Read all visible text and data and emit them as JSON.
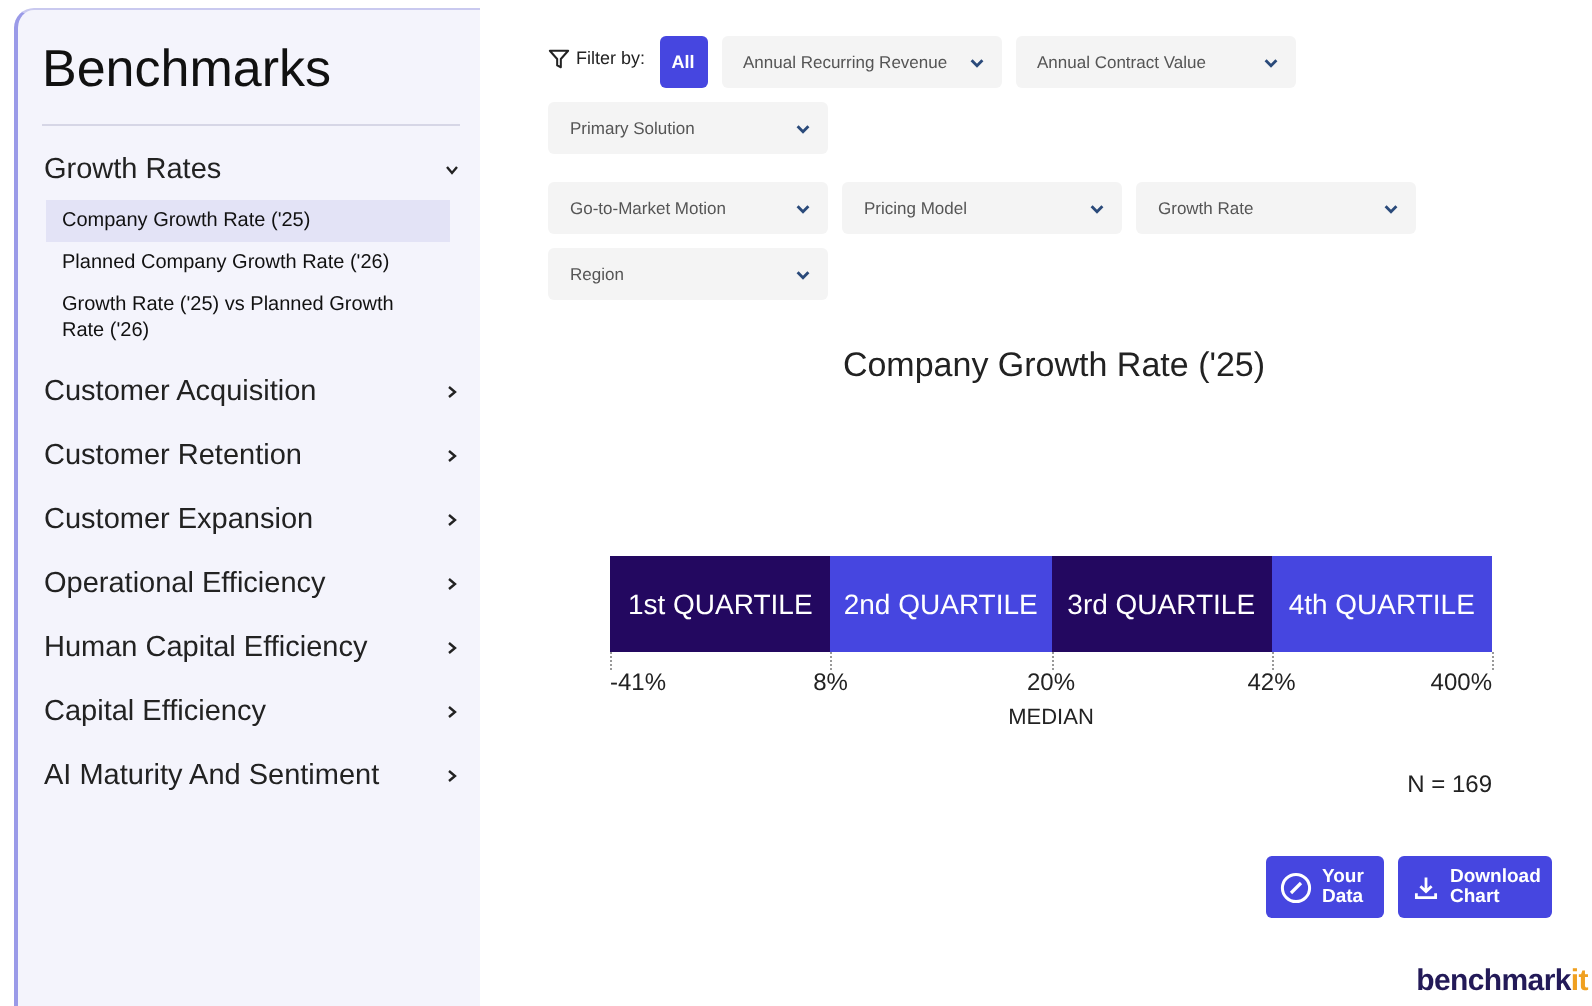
{
  "sidebar": {
    "title": "Benchmarks",
    "sections": [
      {
        "label": "Growth Rates",
        "expanded": true,
        "children": [
          {
            "label": "Company Growth Rate ('25)",
            "selected": true
          },
          {
            "label": "Planned Company Growth Rate ('26)",
            "selected": false
          },
          {
            "label": "Growth Rate ('25) vs Planned Growth Rate ('26)",
            "selected": false
          }
        ]
      },
      {
        "label": "Customer Acquisition",
        "expanded": false
      },
      {
        "label": "Customer Retention",
        "expanded": false
      },
      {
        "label": "Customer Expansion",
        "expanded": false
      },
      {
        "label": "Operational Efficiency",
        "expanded": false
      },
      {
        "label": "Human Capital Efficiency",
        "expanded": false
      },
      {
        "label": "Capital Efficiency",
        "expanded": false
      },
      {
        "label": "AI Maturity And Sentiment",
        "expanded": false
      }
    ]
  },
  "filters": {
    "label": "Filter by:",
    "all_button": "All",
    "dropdowns": [
      {
        "label": "Annual Recurring Revenue"
      },
      {
        "label": "Annual Contract Value"
      },
      {
        "label": "Primary Solution"
      },
      {
        "label": "Go-to-Market Motion"
      },
      {
        "label": "Pricing Model"
      },
      {
        "label": "Growth Rate"
      },
      {
        "label": "Region"
      }
    ]
  },
  "quartiles": {
    "title": "Company Growth Rate ('25)",
    "segments": [
      {
        "label": "1st QUARTILE",
        "color": "#230860"
      },
      {
        "label": "2nd QUARTILE",
        "color": "#4646e0"
      },
      {
        "label": "3rd QUARTILE",
        "color": "#230860"
      },
      {
        "label": "4th QUARTILE",
        "color": "#4646e0"
      }
    ],
    "boundaries": [
      "-41%",
      "8%",
      "20%",
      "42%",
      "400%"
    ],
    "median_label": "MEDIAN",
    "sample_size": "N = 169"
  },
  "buttons": [
    {
      "kind": "edit",
      "label": "Your Data"
    },
    {
      "kind": "download",
      "label": "Download Chart"
    }
  ],
  "logo": {
    "main": "benchmark",
    "accent": "it"
  }
}
